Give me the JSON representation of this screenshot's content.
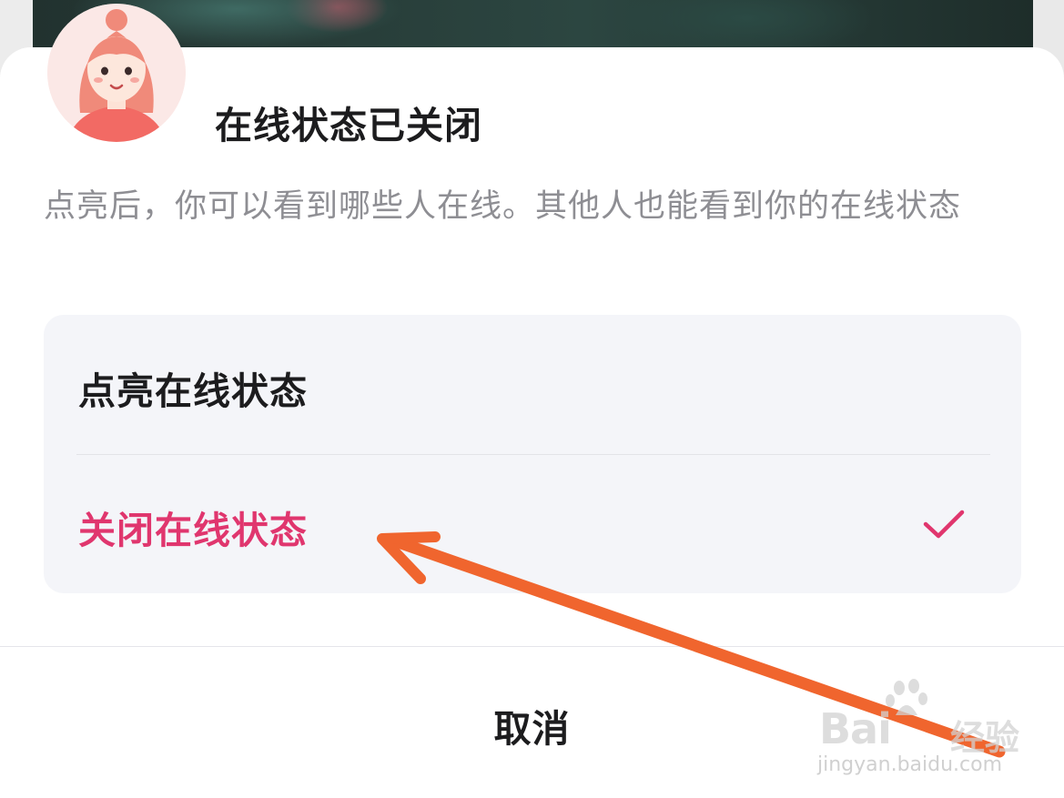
{
  "dialog": {
    "title": "在线状态已关闭",
    "description": "点亮后，你可以看到哪些人在线。其他人也能看到你的在线状态",
    "avatar": "cartoon-girl-avatar"
  },
  "options": [
    {
      "label": "点亮在线状态",
      "selected": false
    },
    {
      "label": "关闭在线状态",
      "selected": true,
      "icon": "checkmark-icon"
    }
  ],
  "footer": {
    "cancel_label": "取消"
  },
  "watermark": {
    "logo": "Bai",
    "logo_suffix": "经验",
    "url": "jingyan.baidu.com"
  },
  "annotation": {
    "icon": "orange-arrow"
  },
  "colors": {
    "accent": "#e0366e",
    "arrow": "#f0652e",
    "option_bg": "#f4f5f9",
    "text_secondary": "#8e8e93"
  }
}
